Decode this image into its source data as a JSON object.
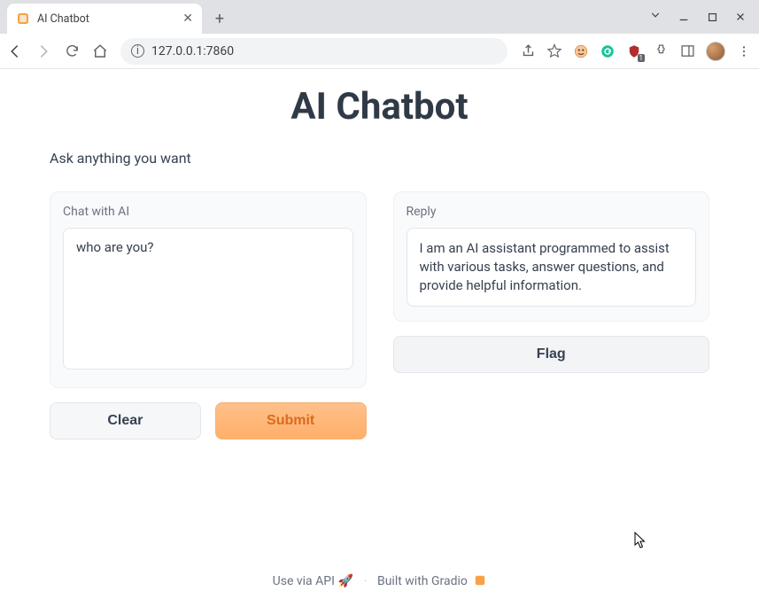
{
  "browser": {
    "tab_title": "AI Chatbot",
    "url": "127.0.0.1:7860"
  },
  "page": {
    "title": "AI Chatbot",
    "subtitle": "Ask anything you want"
  },
  "input": {
    "label": "Chat with AI",
    "value": "who are you?"
  },
  "output": {
    "label": "Reply",
    "value": "I am an AI assistant programmed to assist with various tasks, answer questions, and provide helpful information."
  },
  "buttons": {
    "clear": "Clear",
    "submit": "Submit",
    "flag": "Flag"
  },
  "footer": {
    "api": "Use via API",
    "built": "Built with Gradio"
  },
  "ext_badge": "1"
}
